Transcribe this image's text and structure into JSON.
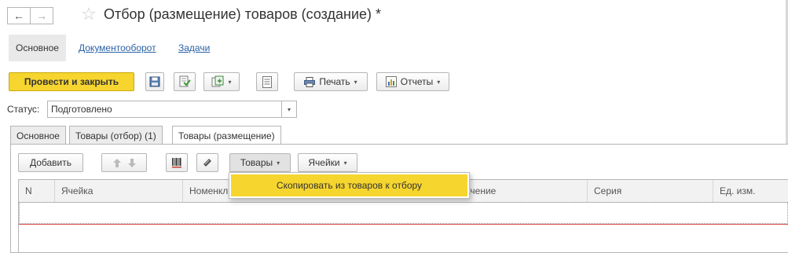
{
  "window": {
    "title": "Отбор (размещение) товаров (создание) *",
    "back_icon": "←",
    "forward_icon": "→",
    "favorite_icon": "☆"
  },
  "top_tabs": [
    "Основное",
    "Документооборот",
    "Задачи"
  ],
  "toolbar": {
    "post_and_close": "Провести и закрыть",
    "print": "Печать",
    "reports": "Отчеты"
  },
  "status": {
    "label": "Статус:",
    "value": "Подготовлено"
  },
  "page_tabs": [
    "Основное",
    "Товары (отбор) (1)",
    "Товары (размещение)"
  ],
  "grid_toolbar": {
    "add": "Добавить",
    "goods": "Товары",
    "cells": "Ячейки"
  },
  "grid": {
    "columns": [
      "N",
      "Ячейка",
      "Номенклатура",
      "Назначение",
      "Серия",
      "Ед. изм."
    ],
    "column_visible": [
      "N",
      "Ячейка",
      "Номенкл",
      "ачение",
      "Серия",
      "Ед. изм."
    ]
  },
  "dropdown_menu": {
    "items": [
      "Скопировать из товаров к отбору"
    ]
  },
  "colors": {
    "accent_yellow": "#f6d52e",
    "link_blue": "#2a62a6",
    "error_line": "#e05050"
  }
}
